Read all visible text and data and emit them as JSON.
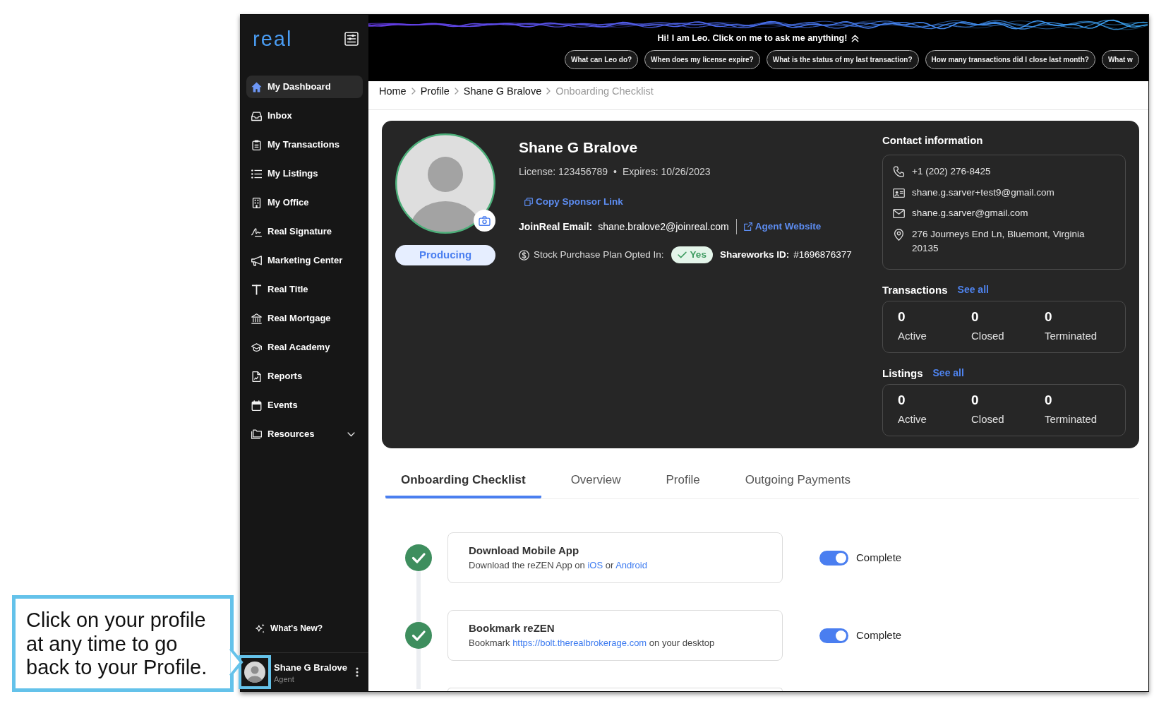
{
  "sidebar": {
    "logo": "real",
    "nav_items": [
      {
        "label": "My Dashboard",
        "kind": "link",
        "selected": true
      },
      {
        "label": "Inbox",
        "kind": "link",
        "selected": false
      },
      {
        "label": "My Transactions",
        "kind": "link",
        "selected": false
      },
      {
        "label": "My Listings",
        "kind": "link",
        "selected": false
      },
      {
        "label": "My Office",
        "kind": "link",
        "selected": false
      },
      {
        "label": "Real Signature",
        "kind": "link",
        "selected": false
      },
      {
        "label": "Marketing Center",
        "kind": "link",
        "selected": false
      },
      {
        "label": "Real Title",
        "kind": "link",
        "selected": false
      },
      {
        "label": "Real Mortgage",
        "kind": "link",
        "selected": false
      },
      {
        "label": "Real Academy",
        "kind": "link",
        "selected": false
      },
      {
        "label": "Reports",
        "kind": "link",
        "selected": false
      },
      {
        "label": "Events",
        "kind": "link",
        "selected": false
      },
      {
        "label": "Resources",
        "kind": "group",
        "selected": false,
        "expanded": false
      }
    ],
    "whats_new": "What's New?",
    "user": {
      "name": "Shane G Bralove",
      "role": "Agent"
    }
  },
  "assistant_bar": {
    "greeting": "Hi! I am Leo. Click on me to ask me anything!",
    "suggestions": [
      "What can Leo do?",
      "When does my license expire?",
      "What is the status of my last transaction?",
      "How many transactions did I close last month?",
      "What w"
    ]
  },
  "breadcrumb": [
    {
      "label": "Home",
      "current": false
    },
    {
      "label": "Profile",
      "current": false
    },
    {
      "label": "Shane G Bralove",
      "current": false
    },
    {
      "label": "Onboarding Checklist",
      "current": true
    }
  ],
  "profile": {
    "name": "Shane G Bralove",
    "license": "License: 123456789",
    "separator": "•",
    "expires": "Expires: 10/26/2023",
    "status": "Producing",
    "copy_sponsor_link": "Copy Sponsor Link",
    "joinreal_email": {
      "label": "JoinReal Email:",
      "value": "shane.bralove2@joinreal.com"
    },
    "agent_website": "Agent Website",
    "stock_plan": {
      "label": "Stock Purchase Plan Opted In:",
      "value": "Yes",
      "opted_in": true
    },
    "shareworks": {
      "label": "Shareworks ID:",
      "value": "#1696876377"
    }
  },
  "contact": {
    "title": "Contact information",
    "items": [
      "+1 (202) 276-8425",
      "shane.g.sarver+test9@gmail.com",
      "shane.g.sarver@gmail.com",
      "276 Journeys End Ln, Bluemont, Virginia 20135"
    ]
  },
  "transactions": {
    "title": "Transactions",
    "link": "See all",
    "stats": [
      {
        "value": "0",
        "label": "Active"
      },
      {
        "value": "0",
        "label": "Closed"
      },
      {
        "value": "0",
        "label": "Terminated"
      }
    ]
  },
  "listings": {
    "title": "Listings",
    "link": "See all",
    "stats": [
      {
        "value": "0",
        "label": "Active"
      },
      {
        "value": "0",
        "label": "Closed"
      },
      {
        "value": "0",
        "label": "Terminated"
      }
    ]
  },
  "tabs": [
    {
      "label": "Onboarding Checklist",
      "selected": true
    },
    {
      "label": "Overview",
      "selected": false
    },
    {
      "label": "Profile",
      "selected": false
    },
    {
      "label": "Outgoing Payments",
      "selected": false
    }
  ],
  "checklist": [
    {
      "title": "Download Mobile App",
      "description": [
        {
          "kind": "text",
          "text": "Download the reZEN App on "
        },
        {
          "kind": "link",
          "text": "iOS"
        },
        {
          "kind": "text",
          "text": " or "
        },
        {
          "kind": "link",
          "text": "Android"
        }
      ],
      "complete": true,
      "status": "Complete"
    },
    {
      "title": "Bookmark reZEN",
      "description": [
        {
          "kind": "text",
          "text": "Bookmark "
        },
        {
          "kind": "link",
          "text": "https://bolt.therealbrokerage.com"
        },
        {
          "kind": "text",
          "text": " on your desktop"
        }
      ],
      "complete": true,
      "status": "Complete"
    }
  ],
  "annotation": {
    "text": "Click on your profile at any time to go back to your Profile."
  }
}
